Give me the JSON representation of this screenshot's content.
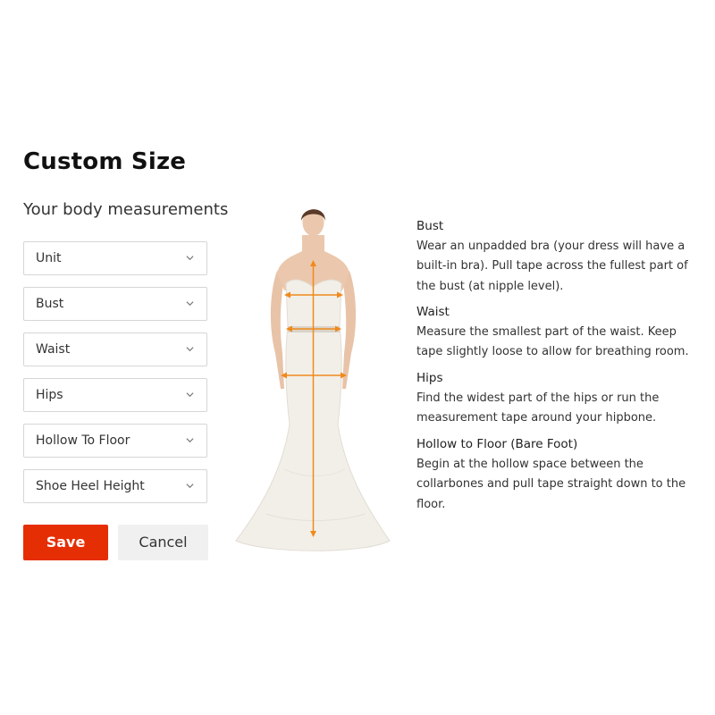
{
  "form": {
    "title": "Custom Size",
    "subtitle": "Your body measurements",
    "fields": [
      {
        "label": "Unit"
      },
      {
        "label": "Bust"
      },
      {
        "label": "Waist"
      },
      {
        "label": "Hips"
      },
      {
        "label": "Hollow To Floor"
      },
      {
        "label": "Shoe Heel Height"
      }
    ],
    "save_label": "Save",
    "cancel_label": "Cancel"
  },
  "guide": [
    {
      "heading": "Bust",
      "text": "Wear an unpadded bra (your dress will have a built-in bra). Pull tape across the fullest part of the bust (at nipple level)."
    },
    {
      "heading": "Waist",
      "text": "Measure the smallest part of the waist. Keep tape slightly loose to allow for breathing room."
    },
    {
      "heading": "Hips",
      "text": "Find the widest part of the hips or run the measurement tape around your hipbone."
    },
    {
      "heading": "Hollow to Floor (Bare Foot)",
      "text": "Begin at the hollow space between the collarbones and pull tape straight down to the floor."
    }
  ],
  "colors": {
    "accent": "#e62e04",
    "measure_line": "#f08a1c"
  },
  "icons": {
    "dropdown": "chevron-down-icon"
  }
}
